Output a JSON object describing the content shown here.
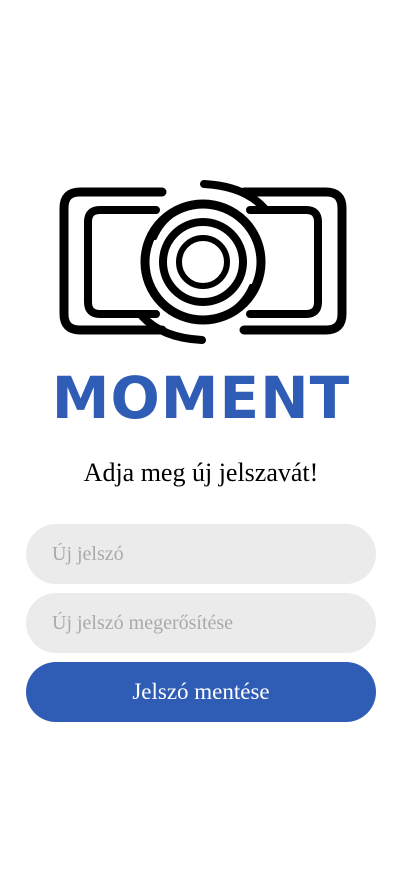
{
  "app": {
    "brand": "MOMENT",
    "logo_icon": "camera-lens-icon",
    "accent_color": "#2f5cb5"
  },
  "reset": {
    "title": "Adja meg új jelszavát!",
    "new_password_placeholder": "Új jelszó",
    "confirm_password_placeholder": "Új jelszó megerősítése",
    "save_label": "Jelszó mentése"
  }
}
